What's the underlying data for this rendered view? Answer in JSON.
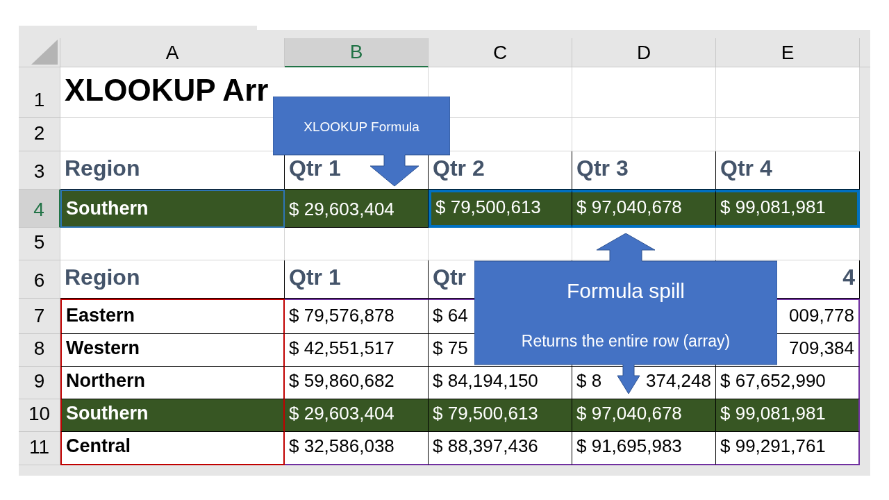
{
  "columns": [
    {
      "label": "A",
      "selected": false
    },
    {
      "label": "B",
      "selected": true
    },
    {
      "label": "C",
      "selected": false
    },
    {
      "label": "D",
      "selected": false
    },
    {
      "label": "E",
      "selected": false
    }
  ],
  "rows": [
    {
      "number": "1",
      "selected": false,
      "boxed": false,
      "highlight": false,
      "cells": [
        {
          "kind": "title",
          "text": "XLOOKUP Arr"
        }
      ]
    },
    {
      "number": "2",
      "selected": false,
      "boxed": false,
      "highlight": false,
      "cells": []
    },
    {
      "number": "3",
      "selected": false,
      "boxed": true,
      "highlight": false,
      "cells": [
        {
          "kind": "header",
          "text": "Region"
        },
        {
          "kind": "header",
          "text": "Qtr 1"
        },
        {
          "kind": "header",
          "text": "Qtr 2"
        },
        {
          "kind": "header",
          "text": "Qtr 3"
        },
        {
          "kind": "header",
          "text": "Qtr 4"
        }
      ]
    },
    {
      "number": "4",
      "selected": true,
      "boxed": true,
      "highlight": true,
      "cells": [
        {
          "kind": "label",
          "text": "Southern"
        },
        {
          "kind": "value",
          "text": "$ 29,603,404"
        },
        {
          "kind": "value",
          "text": "$ 79,500,613"
        },
        {
          "kind": "value",
          "text": "$ 97,040,678"
        },
        {
          "kind": "value",
          "text": "$ 99,081,981"
        }
      ]
    },
    {
      "number": "5",
      "selected": false,
      "boxed": false,
      "highlight": false,
      "cells": []
    },
    {
      "number": "6",
      "selected": false,
      "boxed": true,
      "highlight": false,
      "cells": [
        {
          "kind": "header",
          "text": "Region"
        },
        {
          "kind": "header",
          "text": "Qtr 1"
        },
        {
          "kind": "header",
          "text": "Qtr"
        },
        {
          "kind": "blank"
        },
        {
          "kind": "header",
          "text": "4",
          "right_aligned": true
        }
      ]
    },
    {
      "number": "7",
      "selected": false,
      "boxed": true,
      "highlight": false,
      "cells": [
        {
          "kind": "label",
          "text": "Eastern"
        },
        {
          "kind": "value",
          "text": "$ 79,576,878"
        },
        {
          "kind": "value",
          "text": "$ 64"
        },
        {
          "kind": "blank"
        },
        {
          "kind": "value",
          "text": "009,778",
          "right_aligned": true
        }
      ]
    },
    {
      "number": "8",
      "selected": false,
      "boxed": true,
      "highlight": false,
      "cells": [
        {
          "kind": "label",
          "text": "Western"
        },
        {
          "kind": "value",
          "text": "$ 42,551,517"
        },
        {
          "kind": "value",
          "text": "$ 75"
        },
        {
          "kind": "blank"
        },
        {
          "kind": "value",
          "text": "709,384",
          "right_aligned": true
        }
      ]
    },
    {
      "number": "9",
      "selected": false,
      "boxed": true,
      "highlight": false,
      "cells": [
        {
          "kind": "label",
          "text": "Northern"
        },
        {
          "kind": "value",
          "text": "$ 59,860,682"
        },
        {
          "kind": "value",
          "text": "$ 84,194,150"
        },
        {
          "kind": "value",
          "text": "$ 8",
          "text_after": "374,248"
        },
        {
          "kind": "value",
          "text": "$ 67,652,990"
        }
      ]
    },
    {
      "number": "10",
      "selected": false,
      "boxed": true,
      "highlight": true,
      "cells": [
        {
          "kind": "label",
          "text": "Southern"
        },
        {
          "kind": "value",
          "text": "$ 29,603,404"
        },
        {
          "kind": "value",
          "text": "$ 79,500,613"
        },
        {
          "kind": "value",
          "text": "$ 97,040,678"
        },
        {
          "kind": "value",
          "text": "$ 99,081,981"
        }
      ]
    },
    {
      "number": "11",
      "selected": false,
      "boxed": true,
      "highlight": false,
      "cells": [
        {
          "kind": "label",
          "text": "Central"
        },
        {
          "kind": "value",
          "text": "$ 32,586,038"
        },
        {
          "kind": "value",
          "text": "$ 88,397,436"
        },
        {
          "kind": "value",
          "text": "$ 91,695,983"
        },
        {
          "kind": "value",
          "text": "$ 99,291,761"
        }
      ]
    }
  ],
  "callouts": [
    {
      "kind": "formula",
      "text": "XLOOKUP Formula"
    },
    {
      "kind": "spill",
      "title": "Formula spill",
      "text": "Returns the entire row (array)"
    }
  ]
}
